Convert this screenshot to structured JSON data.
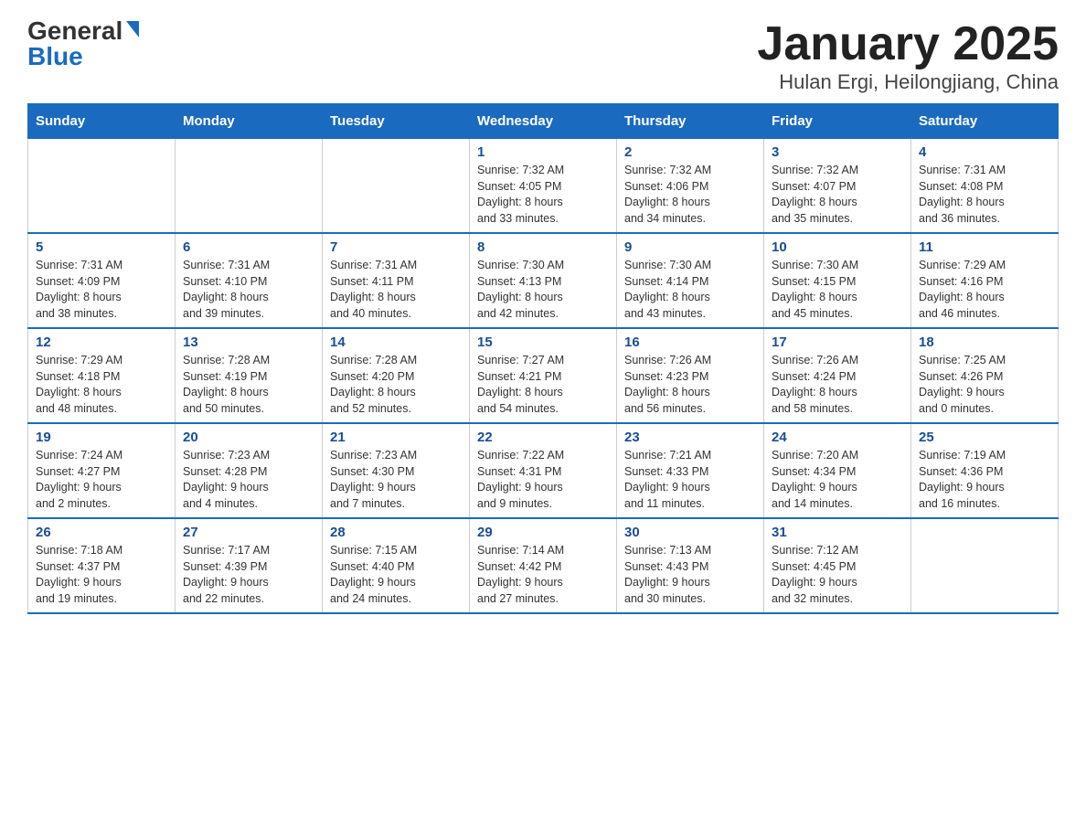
{
  "header": {
    "logo_general": "General",
    "logo_blue": "Blue",
    "month_title": "January 2025",
    "location": "Hulan Ergi, Heilongjiang, China"
  },
  "days_of_week": [
    "Sunday",
    "Monday",
    "Tuesday",
    "Wednesday",
    "Thursday",
    "Friday",
    "Saturday"
  ],
  "weeks": [
    [
      {
        "day": "",
        "info": ""
      },
      {
        "day": "",
        "info": ""
      },
      {
        "day": "",
        "info": ""
      },
      {
        "day": "1",
        "info": "Sunrise: 7:32 AM\nSunset: 4:05 PM\nDaylight: 8 hours\nand 33 minutes."
      },
      {
        "day": "2",
        "info": "Sunrise: 7:32 AM\nSunset: 4:06 PM\nDaylight: 8 hours\nand 34 minutes."
      },
      {
        "day": "3",
        "info": "Sunrise: 7:32 AM\nSunset: 4:07 PM\nDaylight: 8 hours\nand 35 minutes."
      },
      {
        "day": "4",
        "info": "Sunrise: 7:31 AM\nSunset: 4:08 PM\nDaylight: 8 hours\nand 36 minutes."
      }
    ],
    [
      {
        "day": "5",
        "info": "Sunrise: 7:31 AM\nSunset: 4:09 PM\nDaylight: 8 hours\nand 38 minutes."
      },
      {
        "day": "6",
        "info": "Sunrise: 7:31 AM\nSunset: 4:10 PM\nDaylight: 8 hours\nand 39 minutes."
      },
      {
        "day": "7",
        "info": "Sunrise: 7:31 AM\nSunset: 4:11 PM\nDaylight: 8 hours\nand 40 minutes."
      },
      {
        "day": "8",
        "info": "Sunrise: 7:30 AM\nSunset: 4:13 PM\nDaylight: 8 hours\nand 42 minutes."
      },
      {
        "day": "9",
        "info": "Sunrise: 7:30 AM\nSunset: 4:14 PM\nDaylight: 8 hours\nand 43 minutes."
      },
      {
        "day": "10",
        "info": "Sunrise: 7:30 AM\nSunset: 4:15 PM\nDaylight: 8 hours\nand 45 minutes."
      },
      {
        "day": "11",
        "info": "Sunrise: 7:29 AM\nSunset: 4:16 PM\nDaylight: 8 hours\nand 46 minutes."
      }
    ],
    [
      {
        "day": "12",
        "info": "Sunrise: 7:29 AM\nSunset: 4:18 PM\nDaylight: 8 hours\nand 48 minutes."
      },
      {
        "day": "13",
        "info": "Sunrise: 7:28 AM\nSunset: 4:19 PM\nDaylight: 8 hours\nand 50 minutes."
      },
      {
        "day": "14",
        "info": "Sunrise: 7:28 AM\nSunset: 4:20 PM\nDaylight: 8 hours\nand 52 minutes."
      },
      {
        "day": "15",
        "info": "Sunrise: 7:27 AM\nSunset: 4:21 PM\nDaylight: 8 hours\nand 54 minutes."
      },
      {
        "day": "16",
        "info": "Sunrise: 7:26 AM\nSunset: 4:23 PM\nDaylight: 8 hours\nand 56 minutes."
      },
      {
        "day": "17",
        "info": "Sunrise: 7:26 AM\nSunset: 4:24 PM\nDaylight: 8 hours\nand 58 minutes."
      },
      {
        "day": "18",
        "info": "Sunrise: 7:25 AM\nSunset: 4:26 PM\nDaylight: 9 hours\nand 0 minutes."
      }
    ],
    [
      {
        "day": "19",
        "info": "Sunrise: 7:24 AM\nSunset: 4:27 PM\nDaylight: 9 hours\nand 2 minutes."
      },
      {
        "day": "20",
        "info": "Sunrise: 7:23 AM\nSunset: 4:28 PM\nDaylight: 9 hours\nand 4 minutes."
      },
      {
        "day": "21",
        "info": "Sunrise: 7:23 AM\nSunset: 4:30 PM\nDaylight: 9 hours\nand 7 minutes."
      },
      {
        "day": "22",
        "info": "Sunrise: 7:22 AM\nSunset: 4:31 PM\nDaylight: 9 hours\nand 9 minutes."
      },
      {
        "day": "23",
        "info": "Sunrise: 7:21 AM\nSunset: 4:33 PM\nDaylight: 9 hours\nand 11 minutes."
      },
      {
        "day": "24",
        "info": "Sunrise: 7:20 AM\nSunset: 4:34 PM\nDaylight: 9 hours\nand 14 minutes."
      },
      {
        "day": "25",
        "info": "Sunrise: 7:19 AM\nSunset: 4:36 PM\nDaylight: 9 hours\nand 16 minutes."
      }
    ],
    [
      {
        "day": "26",
        "info": "Sunrise: 7:18 AM\nSunset: 4:37 PM\nDaylight: 9 hours\nand 19 minutes."
      },
      {
        "day": "27",
        "info": "Sunrise: 7:17 AM\nSunset: 4:39 PM\nDaylight: 9 hours\nand 22 minutes."
      },
      {
        "day": "28",
        "info": "Sunrise: 7:15 AM\nSunset: 4:40 PM\nDaylight: 9 hours\nand 24 minutes."
      },
      {
        "day": "29",
        "info": "Sunrise: 7:14 AM\nSunset: 4:42 PM\nDaylight: 9 hours\nand 27 minutes."
      },
      {
        "day": "30",
        "info": "Sunrise: 7:13 AM\nSunset: 4:43 PM\nDaylight: 9 hours\nand 30 minutes."
      },
      {
        "day": "31",
        "info": "Sunrise: 7:12 AM\nSunset: 4:45 PM\nDaylight: 9 hours\nand 32 minutes."
      },
      {
        "day": "",
        "info": ""
      }
    ]
  ]
}
